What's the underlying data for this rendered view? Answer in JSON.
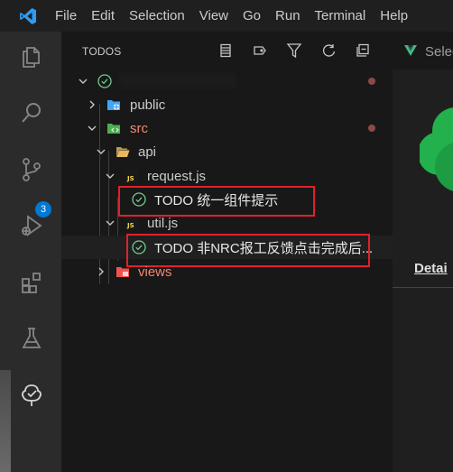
{
  "menu": [
    "File",
    "Edit",
    "Selection",
    "View",
    "Go",
    "Run",
    "Terminal",
    "Help"
  ],
  "activity": {
    "icons": [
      "explorer-icon",
      "search-icon",
      "source-control-icon",
      "run-debug-icon",
      "extensions-icon",
      "testing-icon",
      "todo-tree-icon"
    ],
    "source_control_badge": "3"
  },
  "sidebar": {
    "title": "TODOS",
    "toolbar_icons": [
      "view-as-list-icon",
      "tag-icon",
      "filter-icon",
      "refresh-icon",
      "collapse-all-icon"
    ],
    "tree": {
      "root_label": "",
      "public": "public",
      "src": "src",
      "api": "api",
      "request": "request.js",
      "todo1": "TODO 统一组件提示",
      "util": "util.js",
      "todo2": "TODO 非NRC报工反馈点击完成后...",
      "views": "views"
    }
  },
  "editor": {
    "tab_label": "Selec",
    "detail_label": "Detai"
  },
  "colors": {
    "accent_blue": "#0078d4",
    "todo_green": "#73c991",
    "src_red": "#f48771",
    "highlight_red": "#e0212b",
    "vue_green": "#41b883"
  }
}
